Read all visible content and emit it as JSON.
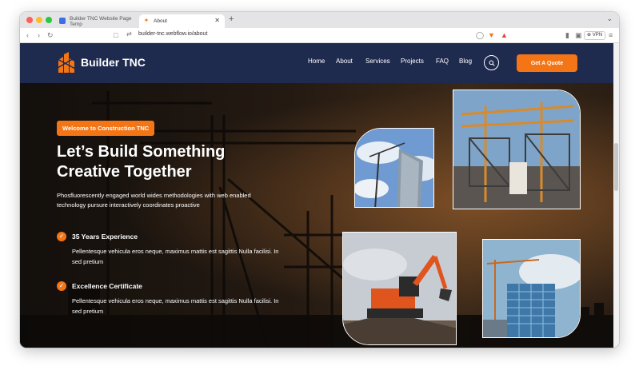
{
  "browser": {
    "tabs": [
      {
        "title": "Builder TNC Website Page Temp"
      },
      {
        "title": "About"
      }
    ],
    "url": "builder-tnc.webflow.io/about",
    "vpn_label": "VPN"
  },
  "site": {
    "logo_text": "Builder TNC",
    "nav": [
      "Home",
      "About",
      "Services",
      "Projects",
      "FAQ",
      "Blog"
    ],
    "quote_button": "Get A Quote"
  },
  "hero": {
    "badge": "Welcome to Construction TNC",
    "title_line1": "Let’s Build Something",
    "title_line2": "Creative Together",
    "subtitle": "Phosfluorescently engaged world wides methodologies with web enabled technology pursure interactively coordinates proactive",
    "features": [
      {
        "title": "35 Years Experience",
        "text": "Pellentesque vehicula eros neque, maximus mattis est sagittis Nulla facilisi. In sed pretium"
      },
      {
        "title": "Excellence Certificate",
        "text": "Pellentesque vehicula eros neque, maximus mattis est sagittis Nulla facilisi. In sed pretium"
      }
    ]
  },
  "colors": {
    "accent": "#f47515",
    "header_bg": "#1f2a4f"
  },
  "icons": [
    "close-icon",
    "plus-icon",
    "back-icon",
    "forward-icon",
    "reload-icon",
    "bookmark-icon",
    "search-icon",
    "check-icon",
    "shield-icon"
  ]
}
